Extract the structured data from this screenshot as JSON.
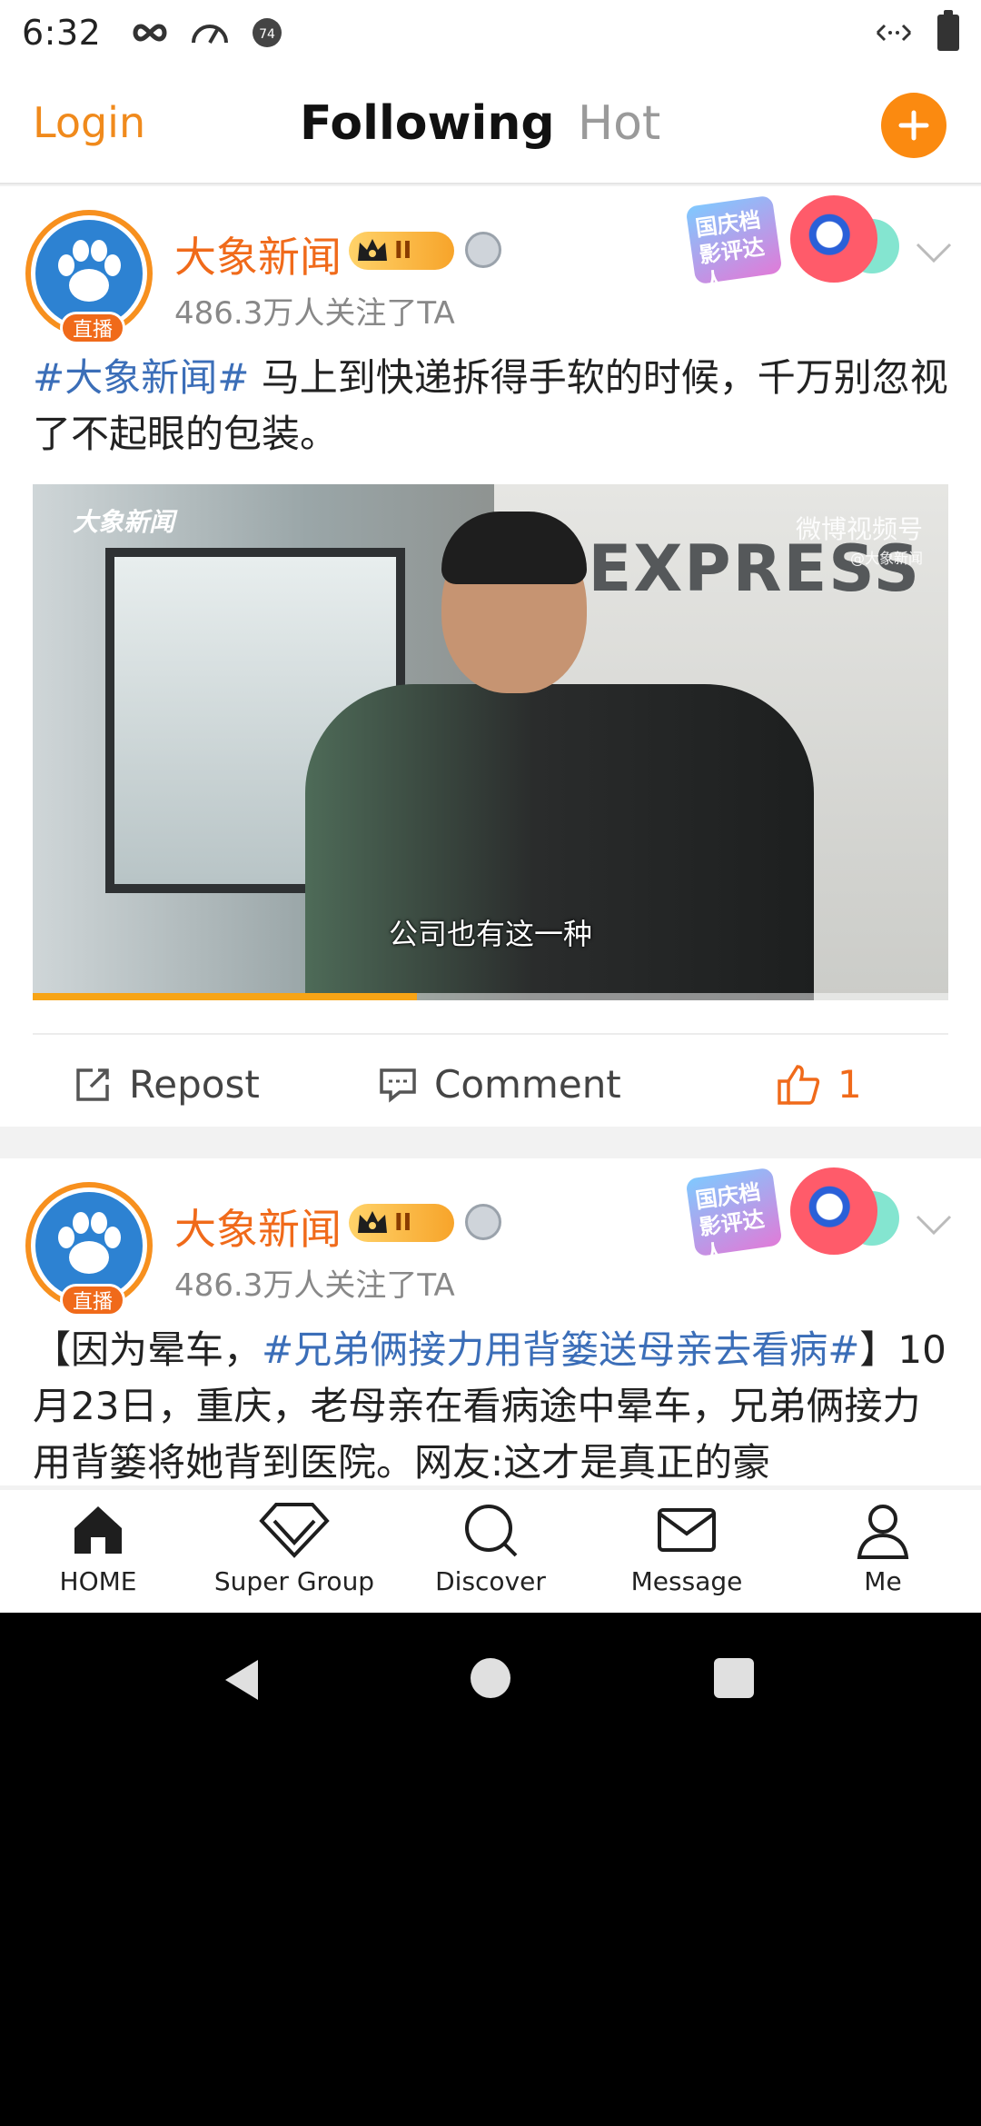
{
  "status_bar": {
    "time": "6:32"
  },
  "top_nav": {
    "login_label": "Login",
    "tabs": [
      {
        "label": "Following",
        "active": true
      },
      {
        "label": "Hot",
        "active": false
      }
    ]
  },
  "posts": [
    {
      "author": "大象新闻",
      "live_badge": "直播",
      "vip_level": "II",
      "followers": "486.3万人关注了TA",
      "event_badge": "国庆档影评达人",
      "topic": "#大象新闻#",
      "text": " 马上到快递拆得手软的时候，千万别忽视了不起眼的包装。",
      "video": {
        "logo_left": "大象新闻",
        "logo_right": "微博视频号",
        "logo_right_sub": "@大象新闻",
        "sign_text": "EXPRESS",
        "subtitle": "公司也有这一种",
        "progress": 0.42
      },
      "actions": {
        "repost": "Repost",
        "comment": "Comment",
        "likes": "1"
      }
    },
    {
      "author": "大象新闻",
      "live_badge": "直播",
      "vip_level": "II",
      "followers": "486.3万人关注了TA",
      "event_badge": "国庆档影评达人",
      "text_prefix": "【因为晕车，",
      "topic": "#兄弟俩接力用背篓送母亲去看病#",
      "text": "】10月23日，重庆，老母亲在看病途中晕车，兄弟俩接力用背篓将她背到医院。网友:这才是真正的豪"
    }
  ],
  "bottom_nav": [
    {
      "label": "HOME",
      "icon": "home-icon"
    },
    {
      "label": "Super Group",
      "icon": "diamond-icon"
    },
    {
      "label": "Discover",
      "icon": "search-icon"
    },
    {
      "label": "Message",
      "icon": "mail-icon"
    },
    {
      "label": "Me",
      "icon": "person-icon"
    }
  ],
  "colors": {
    "accent": "#f08a1c",
    "topic": "#3b6eb8",
    "author": "#f06a1a"
  }
}
